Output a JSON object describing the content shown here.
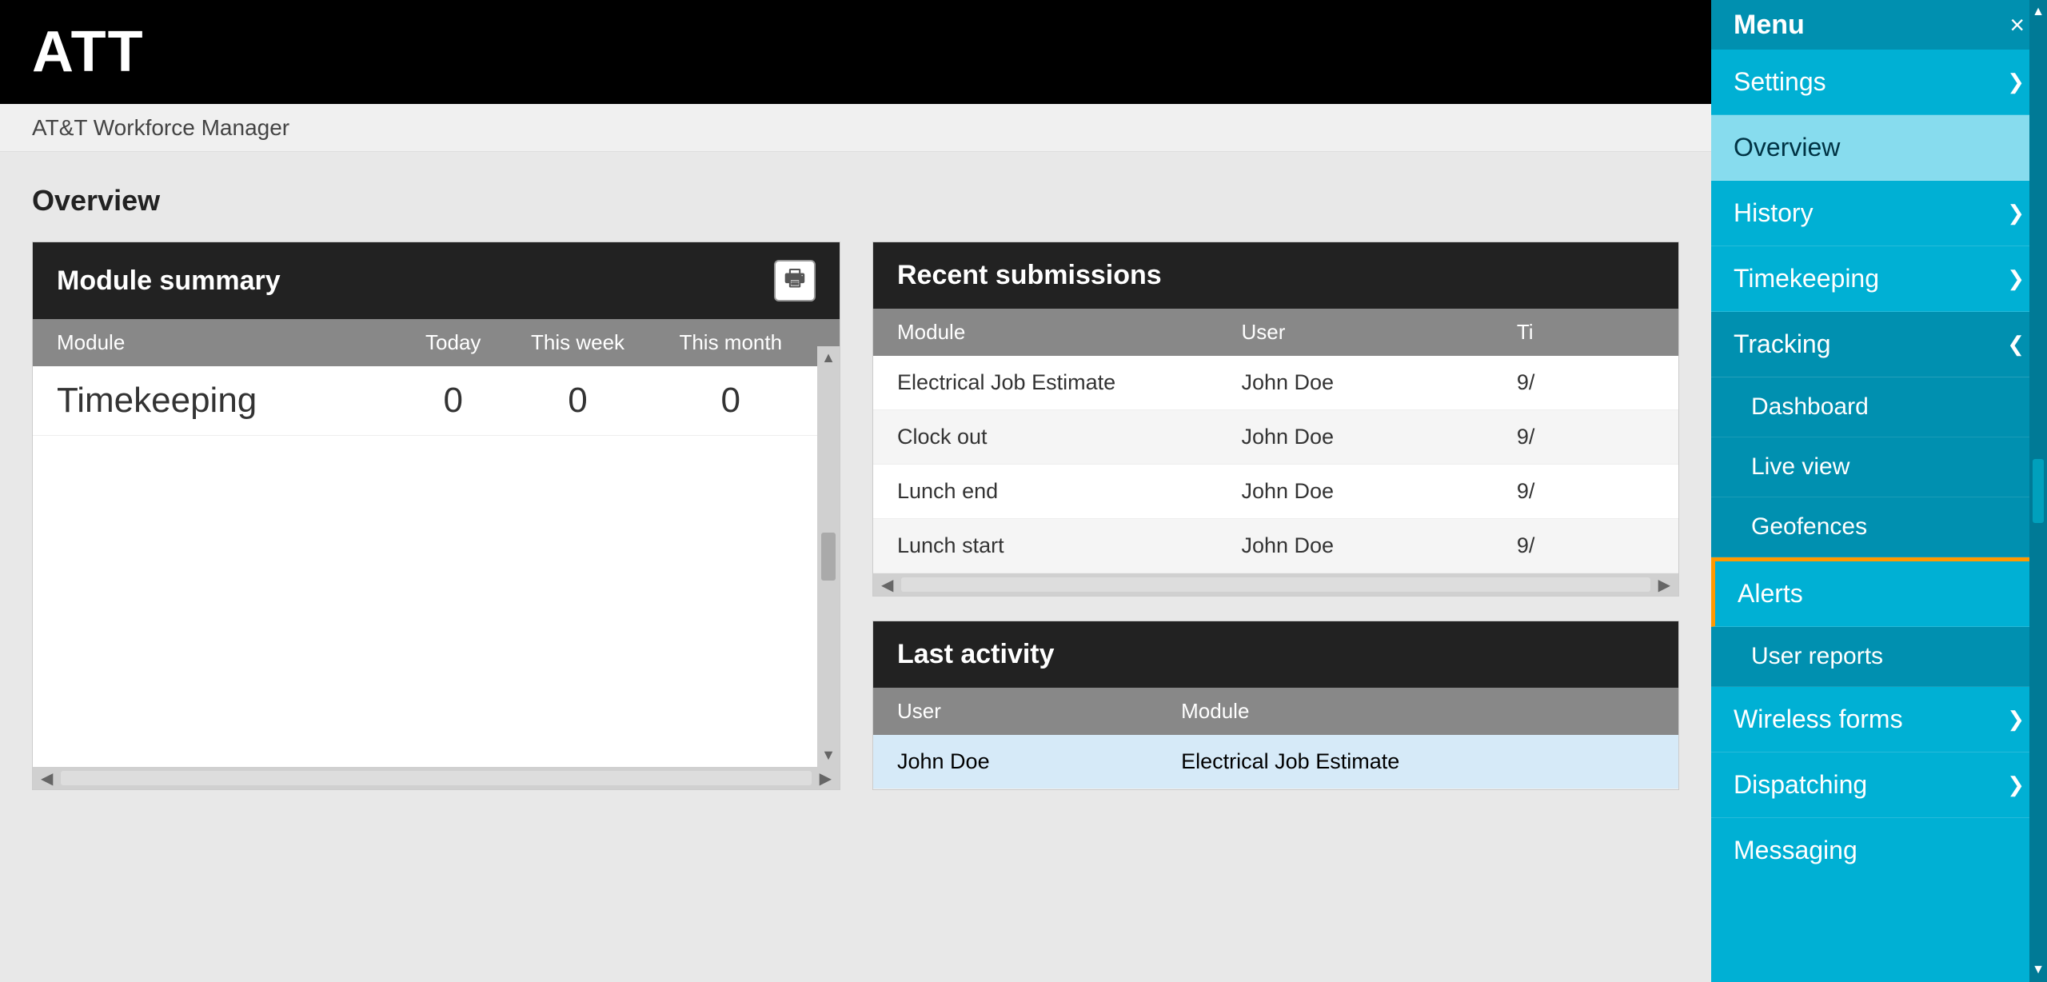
{
  "header": {
    "title": "ATT",
    "subtitle": "AT&T Workforce Manager"
  },
  "overview": {
    "title": "Overview"
  },
  "module_summary": {
    "title": "Module summary",
    "columns": [
      "Module",
      "Today",
      "This week",
      "This month"
    ],
    "rows": [
      {
        "module": "Timekeeping",
        "today": "0",
        "this_week": "0",
        "this_month": "0"
      }
    ]
  },
  "recent_submissions": {
    "title": "Recent submissions",
    "columns": [
      "Module",
      "User",
      "Ti"
    ],
    "rows": [
      {
        "module": "Electrical Job Estimate",
        "user": "John Doe",
        "time": "9/"
      },
      {
        "module": "Clock out",
        "user": "John Doe",
        "time": "9/"
      },
      {
        "module": "Lunch end",
        "user": "John Doe",
        "time": "9/"
      },
      {
        "module": "Lunch start",
        "user": "John Doe",
        "time": "9/"
      }
    ]
  },
  "last_activity": {
    "title": "Last activity",
    "columns": [
      "User",
      "Module"
    ],
    "rows": [
      {
        "user": "John Doe",
        "module": "Electrical Job Estimate"
      }
    ]
  },
  "menu": {
    "title": "Menu",
    "close_label": "×",
    "items": [
      {
        "id": "settings",
        "label": "Settings",
        "has_arrow": true,
        "state": "normal"
      },
      {
        "id": "overview",
        "label": "Overview",
        "has_arrow": false,
        "state": "active"
      },
      {
        "id": "history",
        "label": "History",
        "has_arrow": true,
        "state": "normal"
      },
      {
        "id": "timekeeping",
        "label": "Timekeeping",
        "has_arrow": true,
        "state": "normal"
      },
      {
        "id": "tracking",
        "label": "Tracking",
        "has_arrow": false,
        "state": "expanded",
        "expanded": true
      },
      {
        "id": "dashboard",
        "label": "Dashboard",
        "has_arrow": false,
        "state": "sub"
      },
      {
        "id": "live-view",
        "label": "Live view",
        "has_arrow": false,
        "state": "sub"
      },
      {
        "id": "geofences",
        "label": "Geofences",
        "has_arrow": false,
        "state": "sub"
      },
      {
        "id": "alerts",
        "label": "Alerts",
        "has_arrow": false,
        "state": "alerts"
      },
      {
        "id": "user-reports",
        "label": "User reports",
        "has_arrow": false,
        "state": "sub"
      },
      {
        "id": "wireless-forms",
        "label": "Wireless forms",
        "has_arrow": true,
        "state": "normal"
      },
      {
        "id": "dispatching",
        "label": "Dispatching",
        "has_arrow": true,
        "state": "normal"
      },
      {
        "id": "messaging",
        "label": "Messaging",
        "has_arrow": false,
        "state": "normal"
      }
    ]
  }
}
